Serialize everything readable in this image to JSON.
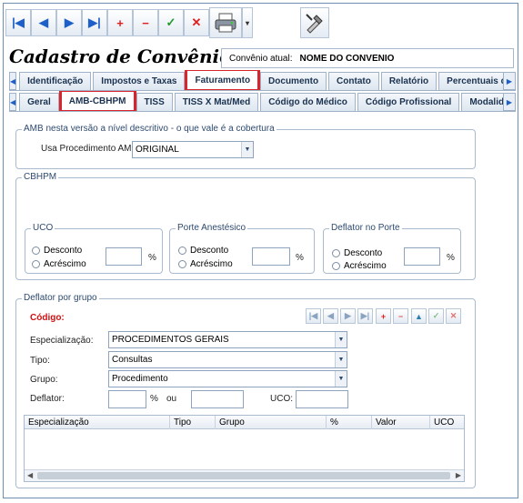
{
  "toolbar": {
    "first": "|◀",
    "prev": "◀",
    "next": "▶",
    "last": "▶|",
    "add": "+",
    "remove": "−",
    "confirm": "✓",
    "cancel": "✕",
    "print": "🖨",
    "dropdown": "▾",
    "tool": "✎"
  },
  "title": "Cadastro de Convênios",
  "current": {
    "label": "Convênio atual:",
    "value": "NOME DO CONVENIO"
  },
  "tabs_main": [
    "Identificação",
    "Impostos e Taxas",
    "Faturamento",
    "Documento",
    "Contato",
    "Relatório",
    "Percentuais de Serv"
  ],
  "tabs_sub": [
    "Geral",
    "AMB-CBHPM",
    "TISS",
    "TISS X Mat/Med",
    "Código do Médico",
    "Código Profissional",
    "Modalidade de"
  ],
  "amb": {
    "legend": "AMB nesta versão a nível descritivo - o que vale é a cobertura",
    "usa_label": "Usa Procedimento AMB:",
    "usa_value": "ORIGINAL"
  },
  "cbhpm": {
    "legend": "CBHPM",
    "uco": {
      "legend": "UCO",
      "opt1": "Desconto",
      "opt2": "Acréscimo",
      "unit": "%"
    },
    "porte": {
      "legend": "Porte Anestésico",
      "opt1": "Desconto",
      "opt2": "Acréscimo",
      "unit": "%"
    },
    "deflator": {
      "legend": "Deflator no Porte",
      "opt1": "Desconto",
      "opt2": "Acréscimo",
      "unit": "%"
    }
  },
  "grupo": {
    "legend": "Deflator por grupo",
    "codigo": "Código:",
    "especializacao_label": "Especialização:",
    "especializacao_value": "PROCEDIMENTOS GERAIS",
    "tipo_label": "Tipo:",
    "tipo_value": "Consultas",
    "grupo_label": "Grupo:",
    "grupo_value": "Procedimento",
    "deflator_label": "Deflator:",
    "pct": "%",
    "ou": "ou",
    "uco_label": "UCO:",
    "columns": [
      "Especialização",
      "Tipo",
      "Grupo",
      "%",
      "Valor",
      "UCO"
    ]
  },
  "colors": {
    "highlight": "#d8252b",
    "code_label": "#d01010"
  }
}
